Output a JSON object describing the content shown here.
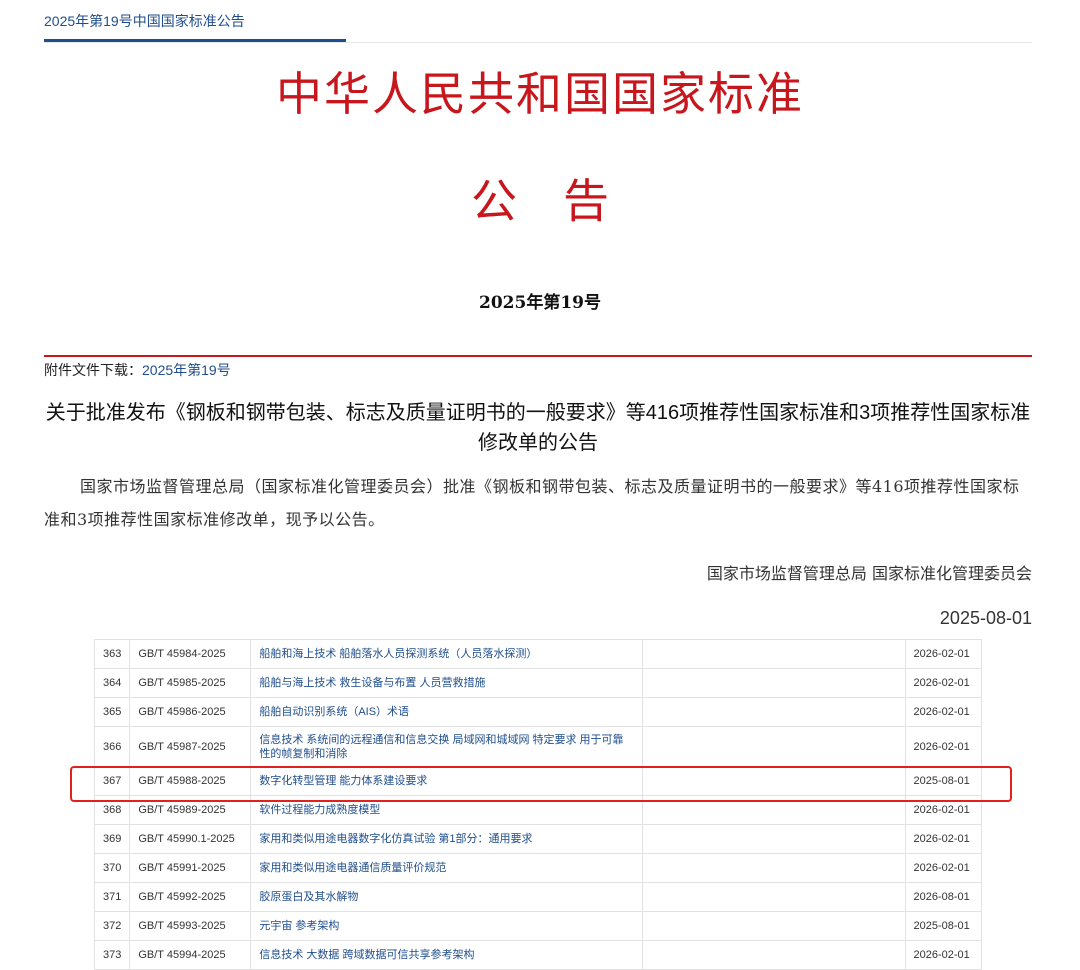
{
  "breadcrumb": "2025年第19号中国国家标准公告",
  "main_title": "中华人民共和国国家标准",
  "notice_title": "公　告",
  "issue": "2025年第19号",
  "attachment": {
    "label": "附件文件下载：",
    "link": "2025年第19号"
  },
  "headline": "关于批准发布《钢板和钢带包装、标志及质量证明书的一般要求》等416项推荐性国家标准和3项推荐性国家标准修改单的公告",
  "body": "国家市场监督管理总局（国家标准化管理委员会）批准《钢板和钢带包装、标志及质量证明书的一般要求》等416项推荐性国家标准和3项推荐性国家标准修改单，现予以公告。",
  "signer": "国家市场监督管理总局 国家标准化管理委员会",
  "date": "2025-08-01",
  "colors": {
    "accent_red": "#c8161d",
    "link_blue": "#1f4e8c",
    "highlight": "#e0211d"
  },
  "table": {
    "rows": [
      {
        "no": "363",
        "code": "GB/T 45984-2025",
        "name": "船舶和海上技术 船舶落水人员探测系统（人员落水探测）",
        "date": "2026-02-01"
      },
      {
        "no": "364",
        "code": "GB/T 45985-2025",
        "name": "船舶与海上技术 救生设备与布置 人员营救措施",
        "date": "2026-02-01"
      },
      {
        "no": "365",
        "code": "GB/T 45986-2025",
        "name": "船舶自动识别系统（AIS）术语",
        "date": "2026-02-01"
      },
      {
        "no": "366",
        "code": "GB/T 45987-2025",
        "name": "信息技术 系统间的远程通信和信息交换 局域网和城域网 特定要求 用于可靠性的帧复制和消除",
        "date": "2026-02-01"
      },
      {
        "no": "367",
        "code": "GB/T 45988-2025",
        "name": "数字化转型管理 能力体系建设要求",
        "date": "2025-08-01"
      },
      {
        "no": "368",
        "code": "GB/T 45989-2025",
        "name": "软件过程能力成熟度模型",
        "date": "2026-02-01"
      },
      {
        "no": "369",
        "code": "GB/T 45990.1-2025",
        "name": "家用和类似用途电器数字化仿真试验 第1部分：通用要求",
        "date": "2026-02-01"
      },
      {
        "no": "370",
        "code": "GB/T 45991-2025",
        "name": "家用和类似用途电器通信质量评价规范",
        "date": "2026-02-01"
      },
      {
        "no": "371",
        "code": "GB/T 45992-2025",
        "name": "胶原蛋白及其水解物",
        "date": "2026-08-01"
      },
      {
        "no": "372",
        "code": "GB/T 45993-2025",
        "name": "元宇宙 参考架构",
        "date": "2025-08-01"
      },
      {
        "no": "373",
        "code": "GB/T 45994-2025",
        "name": "信息技术 大数据 跨域数据可信共享参考架构",
        "date": "2026-02-01"
      }
    ]
  }
}
